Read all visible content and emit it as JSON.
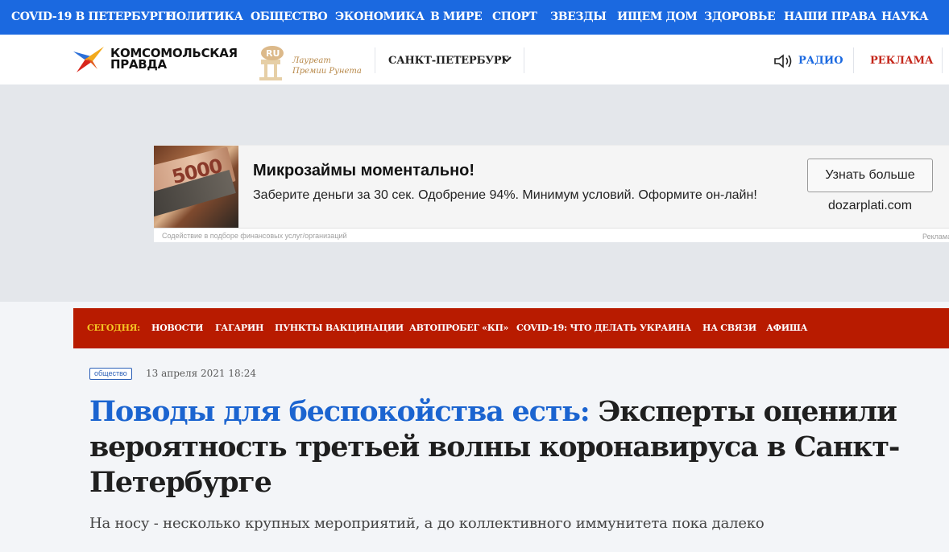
{
  "topnav": {
    "items": [
      "COVID-19 В ПЕТЕРБУРГЕ",
      "ПОЛИТИКА",
      "ОБЩЕСТВО",
      "ЭКОНОМИКА",
      "В МИРЕ",
      "СПОРТ",
      "ЗВЕЗДЫ",
      "ИЩЕМ ДОМ",
      "ЗДОРОВЬЕ",
      "НАШИ ПРАВА",
      "НАУКА"
    ]
  },
  "header": {
    "logo_line1": "КОМСОМОЛЬСКАЯ",
    "logo_line2": "ПРАВДА",
    "award_line1": "Лауреат",
    "award_line2": "Премии Рунета",
    "award_badge": "RU",
    "city": "САНКТ-ПЕТЕРБУРГ",
    "radio": "РАДИО",
    "ads": "РЕКЛАМА"
  },
  "ad": {
    "image_text": "5000",
    "title": "Микрозаймы моментально!",
    "text": "Заберите деньги за 30 сек. Одобрение 94%. Минимум условий. Оформите он-лайн!",
    "button": "Узнать больше",
    "domain": "dozarplati.com",
    "disclaimer": "Содействие в подборе финансовых услуг/организаций",
    "marker": "Реклама"
  },
  "topics": {
    "today": "СЕГОДНЯ:",
    "items": [
      "НОВОСТИ",
      "ГАГАРИН",
      "ПУНКТЫ ВАКЦИНАЦИИ",
      "АВТОПРОБЕГ «КП»",
      "COVID-19: ЧТО ДЕЛАТЬ",
      "УКРАИНА",
      "НА СВЯЗИ",
      "АФИША"
    ]
  },
  "article": {
    "tag": "общество",
    "date": "13 апреля 2021 18:24",
    "headline_accent": "Поводы для беспокойства есть:",
    "headline_rest": "Эксперты оценили вероятность третьей волны коронавируса в Санкт-Петербурге",
    "lead": "На носу - несколько крупных мероприятий, а до коллективного иммунитета пока далеко"
  },
  "colors": {
    "topnav_bg": "#1b69e0",
    "topic_bar_bg": "#b81b00",
    "today_label": "#f5c623",
    "headline_accent": "#1b64d0",
    "ads_label": "#c4261a"
  }
}
